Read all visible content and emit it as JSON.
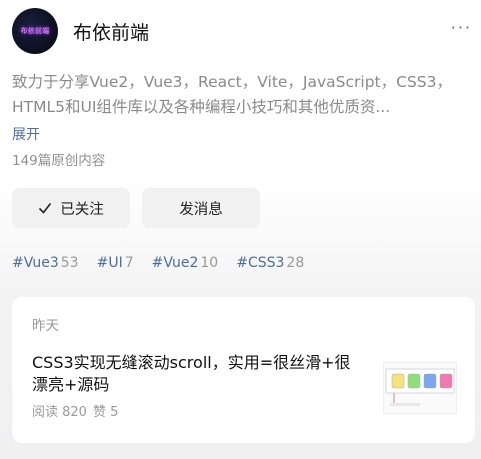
{
  "profile": {
    "avatar_text": "布依前端",
    "name": "布依前端",
    "more_label": "···",
    "description": "致力于分享Vue2，Vue3，React，Vite，JavaScript，CSS3，HTML5和UI组件库以及各种编程小技巧和其他优质资...",
    "expand_label": "展开",
    "post_count": "149篇原创内容"
  },
  "actions": {
    "follow_label": "已关注",
    "message_label": "发消息"
  },
  "tags": [
    {
      "name": "#Vue3",
      "count": "53"
    },
    {
      "name": "#UI",
      "count": "7"
    },
    {
      "name": "#Vue2",
      "count": "10"
    },
    {
      "name": "#CSS3",
      "count": "28"
    }
  ],
  "article": {
    "time": "昨天",
    "title": "CSS3实现无缝滚动scroll，实用=很丝滑+很漂亮+源码",
    "reads": "阅读 820",
    "likes": "赞 5",
    "thumb_colors": [
      "#f5e37a",
      "#8fe07a",
      "#7aa8f0",
      "#f07ab0"
    ]
  }
}
